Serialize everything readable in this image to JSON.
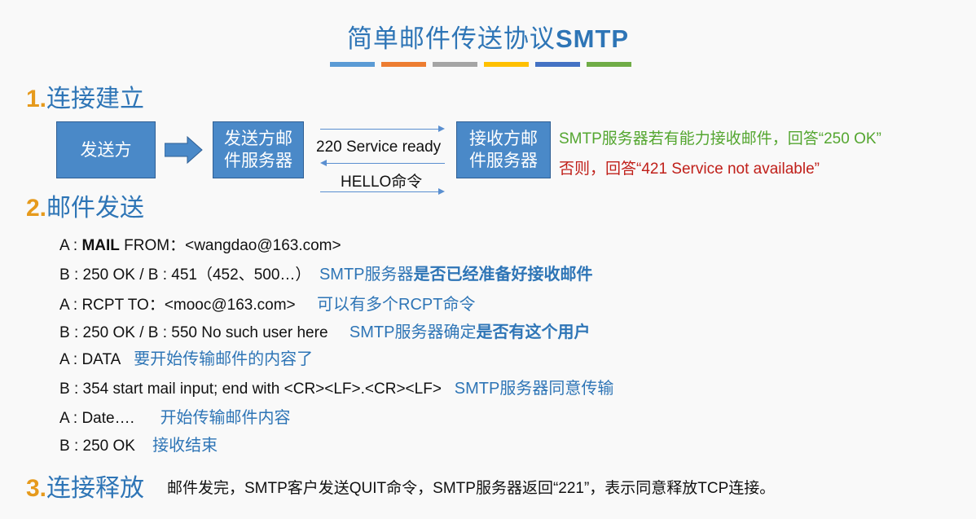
{
  "title": {
    "text": "简单邮件传送协议",
    "bold": "SMTP"
  },
  "stripe_colors": [
    "#5b9bd5",
    "#ed7d31",
    "#a5a5a5",
    "#ffc000",
    "#4472c4",
    "#70ad47"
  ],
  "section1": {
    "num": "1.",
    "label": "连接建立"
  },
  "diagram": {
    "sender": "发送方",
    "send_server_l1": "发送方邮",
    "send_server_l2": "件服务器",
    "recv_server_l1": "接收方邮",
    "recv_server_l2": "件服务器",
    "msg_ready": "220 Service ready",
    "msg_hello": "HELLO命令",
    "reply_ok": "SMTP服务器若有能力接收邮件，回答“250 OK”",
    "reply_fail": "否则，回答“421 Service not available”"
  },
  "section2": {
    "num": "2.",
    "label": "邮件发送"
  },
  "lines": [
    {
      "pre": "A : ",
      "bold": "MAIL",
      "text": " FROM：<wangdao@163.com>",
      "note": "",
      "note_bold": ""
    },
    {
      "pre": "",
      "bold": "",
      "text": "B : 250 OK / B : 451（452、500…）",
      "note": "SMTP服务器",
      "note_bold": "是否已经准备好接收邮件"
    },
    {
      "pre": "",
      "bold": "",
      "text": "A : RCPT TO：<mooc@163.com>",
      "note": "可以有多个RCPT命令",
      "note_bold": ""
    },
    {
      "pre": "",
      "bold": "",
      "text": "B : 250 OK  / B : 550 No such user here",
      "note": "SMTP服务器确定",
      "note_bold": "是否有这个用户"
    },
    {
      "pre": "",
      "bold": "",
      "text": "A : DATA",
      "note": "要开始传输邮件的内容了",
      "note_bold": ""
    },
    {
      "pre": "",
      "bold": "",
      "text": "B : 354 start mail input; end with <CR><LF>.<CR><LF>",
      "note": "SMTP服务器同意传输",
      "note_bold": ""
    },
    {
      "pre": "",
      "bold": "",
      "text": "A : Date….",
      "note": "开始传输邮件内容",
      "note_bold": ""
    },
    {
      "pre": "",
      "bold": "",
      "text": "B : 250 OK",
      "note": "接收结束",
      "note_bold": ""
    }
  ],
  "section3": {
    "num": "3.",
    "label": "连接释放",
    "desc": "邮件发完，SMTP客户发送QUIT命令，SMTP服务器返回“221”，表示同意释放TCP连接。"
  }
}
